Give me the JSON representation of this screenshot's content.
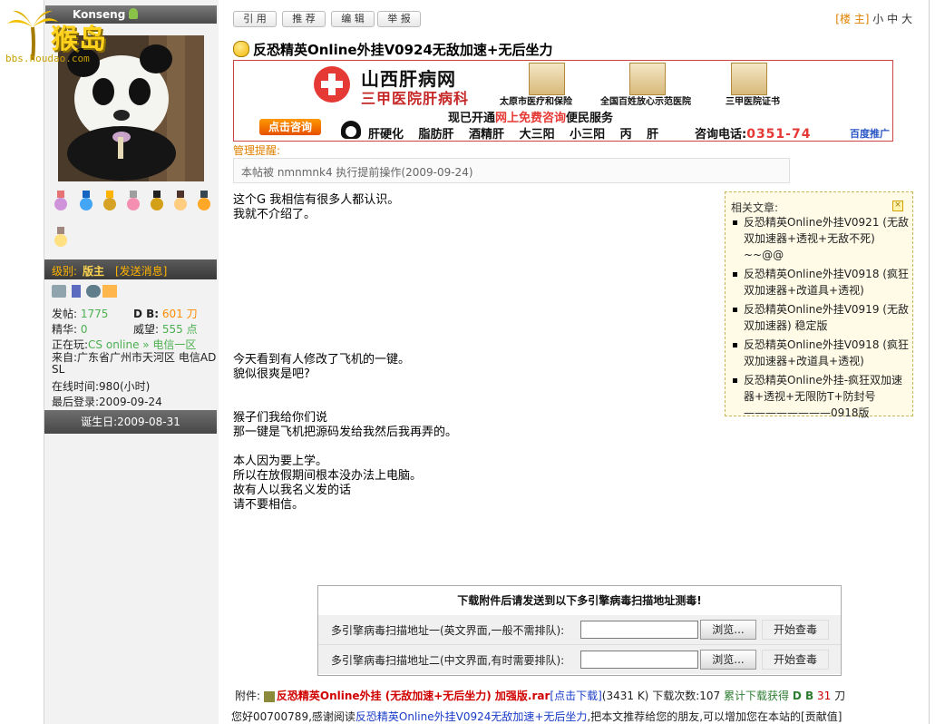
{
  "site": {
    "logo_text": "猴岛",
    "logo_url": "bbs.houdao.com"
  },
  "user": {
    "name": "Konseng",
    "level_label": "级别:",
    "level": "版主",
    "send_message": "[发送消息]",
    "stats": {
      "posts_label": "发帖:",
      "posts": "1775",
      "db_label": "D B:",
      "db": "601 刀",
      "elite_label": "精华:",
      "elite": "0",
      "prestige_label": "威望:",
      "prestige": "555 点",
      "playing_label": "正在玩:",
      "playing": "CS online » 电信一区",
      "from_label": "来自:",
      "from": "广东省广州市天河区 电信ADSL",
      "online_label": "在线时间:",
      "online": "980(小时)",
      "lastlogin_label": "最后登录:",
      "lastlogin": "2009-09-24"
    },
    "birthday": "诞生日:2009-08-31"
  },
  "toolbar": {
    "quote": "引 用",
    "recommend": "推 荐",
    "edit": "编 辑",
    "report": "举 报"
  },
  "floor": {
    "label": "[楼 主]",
    "size_small": "小",
    "size_mid": "中",
    "size_large": "大"
  },
  "post": {
    "title": "反恐精英Online外挂V0924无敌加速+无后坐力",
    "notice_label": "管理提醒:",
    "notice_text": "本帖被  nmnmnk4 执行提前操作(2009-09-24)",
    "lines1": [
      "这个G 我相信有很多人都认识。",
      "我就不介绍了。"
    ],
    "lines2": [
      "今天看到有人修改了飞机的一键。",
      "貌似很爽是吧?"
    ],
    "lines3": [
      "猴子们我给你们说",
      "那一键是飞机把源码发给我然后我再弄的。"
    ],
    "lines4": [
      "本人因为要上学。",
      "所以在放假期间根本没办法上电脑。",
      "故有人以我名义发的话",
      "请不要相信。"
    ]
  },
  "ad": {
    "name": "山西肝病网",
    "sub": "三甲医院肝病科",
    "caps": [
      "太原市医疗和保险",
      "全国百姓放心示范医院",
      "三甲医院证书"
    ],
    "consult": "点击咨询",
    "headline_a": "现已开通",
    "headline_b": "网上免费咨询",
    "headline_c": "便民服务",
    "items": "肝硬化 脂肪肝 酒精肝 大三阳 小三阳 丙 肝",
    "phone_label": "咨询电话:",
    "phone": "0351-74",
    "baidu": "百度推广"
  },
  "related": {
    "title": "相关文章:",
    "items": [
      "反恐精英Online外挂V0921 (无敌双加速器+透视+无敌不死) ~~@@",
      "反恐精英Online外挂V0918 (疯狂双加速器+改道具+透视)",
      "反恐精英Online外挂V0919 (无敌双加速器) 稳定版",
      "反恐精英Online外挂V0918 (疯狂双加速器+改道具+透视)",
      "反恐精英Online外挂-疯狂双加速器+透视+无限防T+防封号————————0918版"
    ]
  },
  "scan": {
    "title": "下载附件后请发送到以下多引擎病毒扫描地址测毒!",
    "row1_label": "多引擎病毒扫描地址一(英文界面,一般不需排队):",
    "row2_label": "多引擎病毒扫描地址二(中文界面,有时需要排队):",
    "browse": "浏览...",
    "start": "开始查毒"
  },
  "attachment": {
    "label": "附件:",
    "file": "反恐精英Online外挂 (无敌加速+无后坐力) 加强版.rar",
    "download": "[点击下载]",
    "size": "(3431 K)",
    "count": "下载次数:107",
    "earn": "累计下载获得",
    "db": "D B",
    "db_val": "31",
    "unit": "刀"
  },
  "thanks": {
    "pre": "您好00700789,感谢阅读",
    "link": "反恐精英Online外挂V0924无敌加速+无后坐力",
    "post": ",把本文推荐给您的朋友,可以增加您在本站的[贡献值]"
  }
}
